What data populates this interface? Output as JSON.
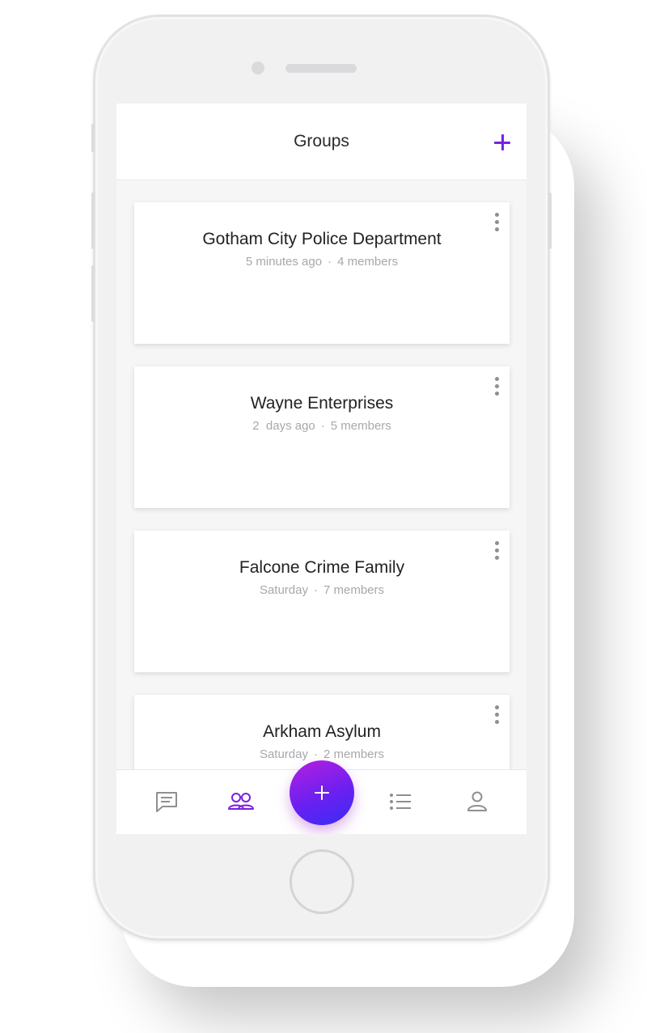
{
  "header": {
    "title": "Groups",
    "add_icon": "plus-icon"
  },
  "groups": [
    {
      "name": "Gotham City Police Department",
      "time": "5 minutes ago",
      "members": "4 members"
    },
    {
      "name": "Wayne Enterprises",
      "time": "2  days ago",
      "members": "5 members"
    },
    {
      "name": "Falcone Crime Family",
      "time": "Saturday",
      "members": "7 members"
    },
    {
      "name": "Arkham Asylum",
      "time": "Saturday",
      "members": "2 members"
    }
  ],
  "meta_separator": "·",
  "tabbar": {
    "items": [
      {
        "name": "messages",
        "icon": "chat-icon",
        "active": false
      },
      {
        "name": "groups",
        "icon": "people-icon",
        "active": true
      },
      {
        "name": "add",
        "icon": "plus-icon",
        "active": false
      },
      {
        "name": "list",
        "icon": "list-icon",
        "active": false
      },
      {
        "name": "profile",
        "icon": "person-icon",
        "active": false
      }
    ]
  },
  "colors": {
    "accent": "#7a1fe0",
    "fab_gradient_start": "#b61fe0",
    "fab_gradient_end": "#3a2cf5",
    "icon_inactive": "#8f8f93"
  }
}
